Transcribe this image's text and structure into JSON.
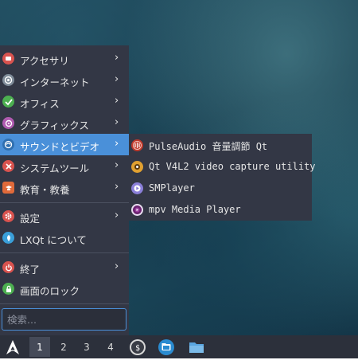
{
  "menu": {
    "items": [
      {
        "label": "アクセサリ",
        "has_submenu": true,
        "icon": "accessories-icon",
        "color": "#d9534f"
      },
      {
        "label": "インターネット",
        "has_submenu": true,
        "icon": "internet-icon",
        "color": "#7f8c99"
      },
      {
        "label": "オフィス",
        "has_submenu": true,
        "icon": "office-icon",
        "color": "#4caf50"
      },
      {
        "label": "グラフィックス",
        "has_submenu": true,
        "icon": "graphics-icon",
        "color": "#b05bb0"
      },
      {
        "label": "サウンドとビデオ",
        "has_submenu": true,
        "icon": "sound-video-icon",
        "color": "#4a90d9",
        "active": true
      },
      {
        "label": "システムツール",
        "has_submenu": true,
        "icon": "system-tools-icon",
        "color": "#d9534f"
      },
      {
        "label": "教育・教養",
        "has_submenu": true,
        "icon": "education-icon",
        "color": "#e06a3a"
      }
    ],
    "settings_items": [
      {
        "label": "設定",
        "has_submenu": true,
        "icon": "settings-icon",
        "color": "#d9534f"
      },
      {
        "label": "LXQt について",
        "has_submenu": false,
        "icon": "about-icon",
        "color": "#3a9fd9"
      }
    ],
    "system_items": [
      {
        "label": "終了",
        "has_submenu": true,
        "icon": "shutdown-icon",
        "color": "#d9534f"
      },
      {
        "label": "画面のロック",
        "has_submenu": false,
        "icon": "lock-icon",
        "color": "#4caf50"
      }
    ],
    "search_placeholder": "検索..."
  },
  "submenu": {
    "items": [
      {
        "label": "PulseAudio 音量調節 Qt",
        "icon": "pulseaudio-icon",
        "color": "#c0392b"
      },
      {
        "label": "Qt V4L2 video capture utility",
        "icon": "v4l2-icon",
        "color": "#e0a030"
      },
      {
        "label": "SMPlayer",
        "icon": "smplayer-icon",
        "color": "#8a7fd9"
      },
      {
        "label": "mpv Media Player",
        "icon": "mpv-icon",
        "color": "#9b3fa0"
      }
    ]
  },
  "taskbar": {
    "desktops": [
      "1",
      "2",
      "3",
      "4"
    ],
    "current_desktop": "1",
    "launchers": [
      "terminal-icon",
      "file-manager-icon",
      "folder-icon"
    ]
  }
}
